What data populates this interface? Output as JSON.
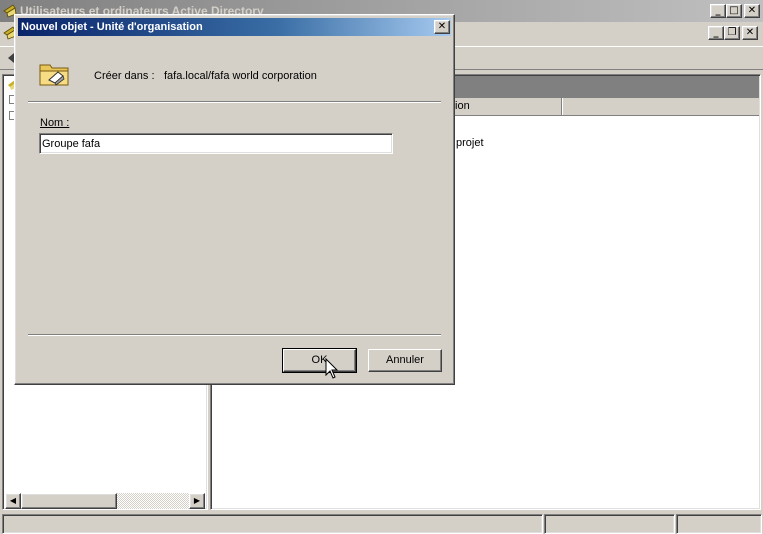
{
  "main_window": {
    "title": "Utilisateurs et ordinateurs Active Directory",
    "title_buttons": [
      "_",
      "□",
      "✕"
    ],
    "mdi_buttons": [
      "_",
      "❐",
      "✕"
    ],
    "list_column_partial": "tion",
    "list_row_partial": "projet"
  },
  "dialog": {
    "title": "Nouvel objet - Unité d'organisation",
    "close_glyph": "✕",
    "create_in_label": "Créer dans :",
    "create_in_path": "fafa.local/fafa world corporation",
    "name_label": "Nom :",
    "name_value": "Groupe fafa",
    "ok_label": "OK",
    "cancel_label": "Annuler"
  },
  "icons": {
    "folder": "folder-icon",
    "mouse_cursor": "mouse-cursor-icon",
    "scroll_left": "scroll-left-icon",
    "scroll_right": "scroll-right-icon"
  },
  "colors": {
    "dialog_title_start": "#0a246a",
    "dialog_title_end": "#a6caf0",
    "inactive_title": "#808080",
    "face": "#d4d0c8"
  }
}
